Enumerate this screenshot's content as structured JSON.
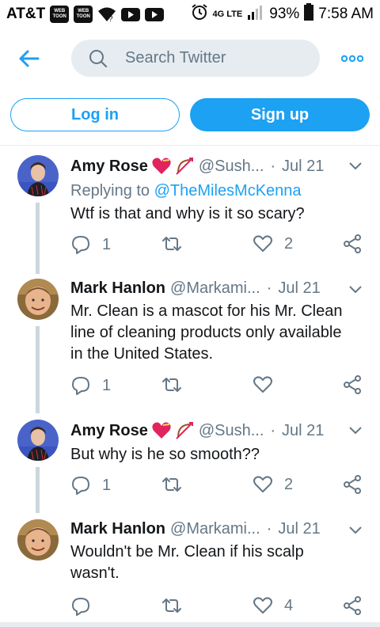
{
  "status_bar": {
    "carrier": "AT&T",
    "app_badge_1": "WEB TOON",
    "app_badge_2": "WEB TOON",
    "network": "4G LTE",
    "battery": "93%",
    "time": "7:58 AM"
  },
  "header": {
    "search_placeholder": "Search Twitter",
    "accent_color": "#1da1f2"
  },
  "auth": {
    "login_label": "Log in",
    "signup_label": "Sign up"
  },
  "tweets": [
    {
      "name": "Amy Rose",
      "handle": "@Sush...",
      "date": "Jul 21",
      "reply_prefix": "Replying to",
      "reply_mention": "@TheMilesMcKenna",
      "text": "Wtf is that and why is it so scary?",
      "replies": "1",
      "retweets": "",
      "likes": "2"
    },
    {
      "name": "Mark Hanlon",
      "handle": "@Markami...",
      "date": "Jul 21",
      "text_lines": [
        "Mr. Clean is a mascot for his Mr. Clean",
        "line of cleaning products only available",
        "in the United States."
      ],
      "replies": "1",
      "retweets": "",
      "likes": ""
    },
    {
      "name": "Amy Rose",
      "handle": "@Sush...",
      "date": "Jul 21",
      "text": "But why is he so smooth??",
      "replies": "1",
      "retweets": "",
      "likes": "2"
    },
    {
      "name": "Mark Hanlon",
      "handle": "@Markami...",
      "date": "Jul 21",
      "text_lines": [
        "Wouldn't be Mr. Clean if his scalp",
        "wasn't."
      ],
      "replies": "",
      "retweets": "",
      "likes": "4"
    }
  ],
  "icons": [
    "back-arrow-icon",
    "search-icon",
    "more-dots-icon",
    "chevron-down-icon",
    "reply-icon",
    "retweet-icon",
    "like-heart-icon",
    "share-icon",
    "heart-emoji-icon",
    "bow-arrow-emoji-icon"
  ]
}
